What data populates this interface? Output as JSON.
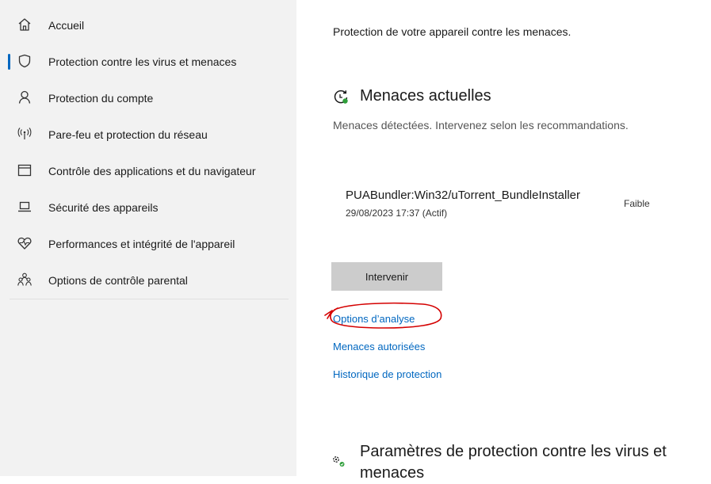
{
  "sidebar": {
    "items": [
      {
        "label": "Accueil",
        "icon": "home-icon"
      },
      {
        "label": "Protection contre les virus et menaces",
        "icon": "shield-icon",
        "selected": true
      },
      {
        "label": "Protection du compte",
        "icon": "person-icon"
      },
      {
        "label": "Pare-feu et protection du réseau",
        "icon": "wireless-icon"
      },
      {
        "label": "Contrôle des applications et du navigateur",
        "icon": "app-window-icon"
      },
      {
        "label": "Sécurité des appareils",
        "icon": "laptop-icon"
      },
      {
        "label": "Performances et intégrité de l'appareil",
        "icon": "heart-pulse-icon"
      },
      {
        "label": "Options de contrôle parental",
        "icon": "family-icon"
      }
    ]
  },
  "main": {
    "intro": "Protection de votre appareil contre les menaces.",
    "threats": {
      "title": "Menaces actuelles",
      "subtitle": "Menaces détectées. Intervenez selon les recommandations.",
      "item": {
        "name": "PUABundler:Win32/uTorrent_BundleInstaller",
        "date": "29/08/2023 17:37 (Actif)",
        "severity": "Faible"
      },
      "action_label": "Intervenir",
      "links": [
        "Options d’analyse",
        "Menaces autorisées",
        "Historique de protection"
      ]
    },
    "settings": {
      "title": "Paramètres de protection contre les virus et menaces"
    }
  },
  "colors": {
    "sidebar_bg": "#f2f2f2",
    "accent": "#0067c0",
    "button_bg": "#cccccc",
    "annotation": "#d40000",
    "success": "#2e9e3a"
  }
}
